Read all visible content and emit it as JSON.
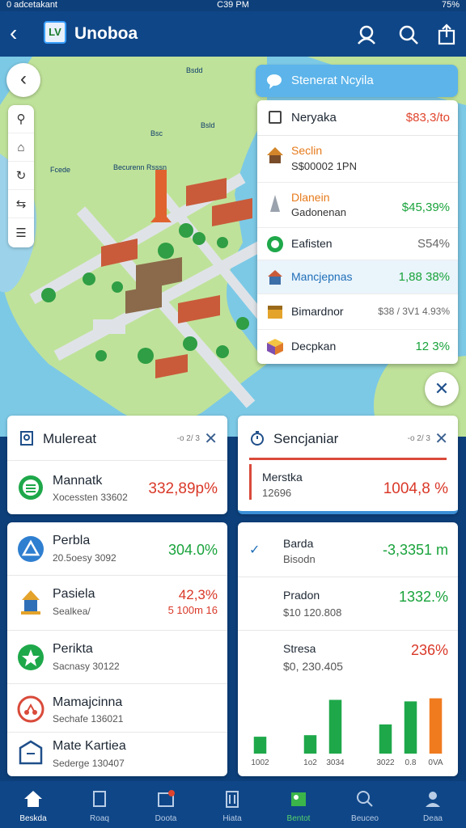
{
  "statusbar": {
    "left": "0 adcetakant",
    "time": "C39 PM",
    "battery": "75%"
  },
  "header": {
    "logo_text": "LV",
    "title": "Unoboa"
  },
  "map": {
    "labels": [
      "Bsdd",
      "Bsld",
      "Bsc",
      "Fcede",
      "Becurenn Rsssn"
    ],
    "search_placeholder": "Stenerat Ncyila"
  },
  "ranking": {
    "header": {
      "name": "Neryaka",
      "value": "$83,3/to"
    },
    "rows": [
      {
        "name": "Seclin",
        "sub": "S$00002 1PN",
        "value": "",
        "name_color": "orange",
        "icon": "temple-icon"
      },
      {
        "name": "Dlanein",
        "sub": "Gadonenan",
        "value": "$45,39%",
        "name_color": "orange",
        "value_color": "green",
        "icon": "tower-icon"
      },
      {
        "name": "Eafisten",
        "sub": "",
        "value": "S54%",
        "value_color": "gray",
        "icon": "shield-icon"
      },
      {
        "name": "Mancjepnas",
        "sub": "",
        "value": "1,88 38%",
        "name_color": "blue",
        "value_color": "green",
        "icon": "house-icon"
      },
      {
        "name": "Bimardnor",
        "sub": "",
        "value": "$38 / 3V1 4.93%",
        "value_color": "gray",
        "icon": "box-icon"
      },
      {
        "name": "Decpkan",
        "sub": "",
        "value": "12 3%",
        "value_color": "green",
        "icon": "cube-icon"
      }
    ]
  },
  "left_panel": {
    "title": "Mulereat",
    "meta": "-o 2/ 3",
    "featured": {
      "name": "Mannatk",
      "sub": "Xocessten 33602",
      "value": "332,89p%"
    },
    "rows": [
      {
        "name": "Perbla",
        "sub": "20.5oesy 3092",
        "value": "304.0%",
        "value_color": "green",
        "icon": "triangle-icon"
      },
      {
        "name": "Pasiela",
        "sub": "Sealkea/",
        "value": "42,3%",
        "value2": "5 100m 16",
        "value_color": "red",
        "icon": "pagoda-icon"
      },
      {
        "name": "Perikta",
        "sub": "Sacnasy 30122",
        "value": "",
        "icon": "star-icon"
      },
      {
        "name": "Mamajcinna",
        "sub": "Sechafe 136021",
        "value": "",
        "icon": "scooter-icon"
      },
      {
        "name": "Mate Kartiea",
        "sub": "Sederge 130407",
        "value": "",
        "icon": "bag-icon"
      }
    ]
  },
  "right_panel": {
    "title": "Sencjaniar",
    "meta": "-o 2/ 3",
    "featured": {
      "name": "Merstka",
      "sub": "12696",
      "value": "1004,8 %"
    },
    "rows": [
      {
        "name": "Barda",
        "sub": "Bisodn",
        "value": "-3,3351 m",
        "value_color": "green",
        "checked": true
      },
      {
        "name": "Pradon",
        "sub": "$10 120.808",
        "value": "1332.%",
        "value_color": "green"
      },
      {
        "name": "Stresa",
        "sub": "$0, 230.405",
        "value": "236%",
        "value_color": "red"
      }
    ],
    "chart_data": {
      "type": "bar",
      "categories": [
        "1002",
        "",
        "1o2",
        "3034",
        "",
        "3022",
        "0.8",
        "0VA"
      ],
      "values": [
        22,
        0,
        24,
        70,
        0,
        38,
        68,
        72
      ],
      "colors": [
        "#1ea84a",
        "#1ea84a",
        "#1ea84a",
        "#1ea84a",
        "#1ea84a",
        "#1ea84a",
        "#1ea84a",
        "#f07b1f"
      ],
      "ylim": [
        0,
        80
      ],
      "title": "",
      "xlabel": "",
      "ylabel": ""
    }
  },
  "bottomnav": [
    {
      "label": "Beskda",
      "icon": "home-icon",
      "active": true
    },
    {
      "label": "Roaq",
      "icon": "bookmark-icon"
    },
    {
      "label": "Doota",
      "icon": "calendar-icon"
    },
    {
      "label": "Hiata",
      "icon": "building-icon"
    },
    {
      "label": "Bentot",
      "icon": "map-icon",
      "green": true
    },
    {
      "label": "Beuceo",
      "icon": "search-icon"
    },
    {
      "label": "Deaa",
      "icon": "profile-icon"
    }
  ],
  "colors": {
    "primary": "#0f4687",
    "accent": "#5cb4ea",
    "green": "#19a33b",
    "red": "#d93828"
  }
}
